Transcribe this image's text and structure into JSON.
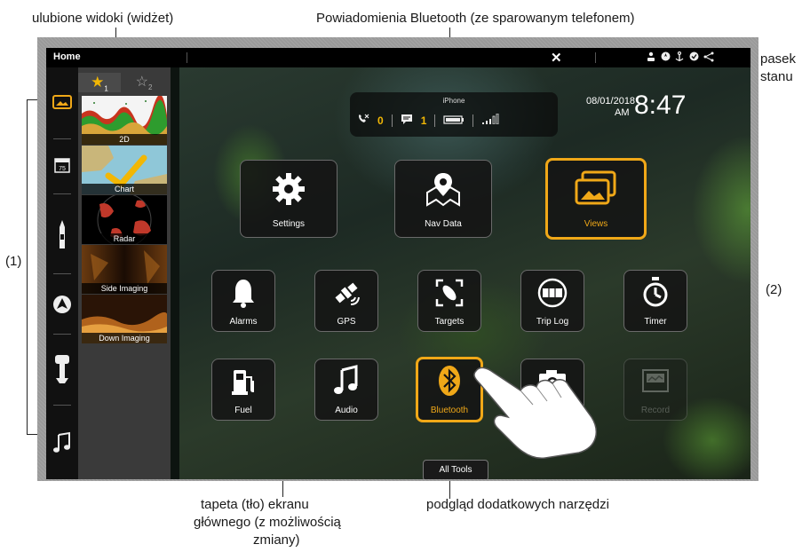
{
  "callouts": {
    "favorites_widget": "ulubione widoki (widżet)",
    "bluetooth_notifications": "Powiadomienia Bluetooth (ze sparowanym telefonem)",
    "status_bar_line1": "pasek",
    "status_bar_line2": "stanu",
    "label_1": "(1)",
    "label_2": "(2)",
    "wallpaper_line1": "tapeta (tło) ekranu",
    "wallpaper_line2": "głównego (z możliwością",
    "wallpaper_line3": "zmiany)",
    "more_tools": "podgląd dodatkowych narzędzi"
  },
  "topbar": {
    "title": "Home",
    "close_glyph": "✕",
    "status_icons": [
      "user-icon",
      "compass-icon",
      "anchor-icon",
      "gps-check-icon",
      "network-icon"
    ]
  },
  "leftbar": {
    "items": [
      "views-icon",
      "calendar-75-icon",
      "boat-icon",
      "autopilot-icon",
      "motor-icon",
      "audio-icon"
    ],
    "calendar_value": "75"
  },
  "favorites": {
    "tab1_label": "1",
    "tab2_label": "2",
    "views": [
      "2D",
      "Chart",
      "Radar",
      "Side Imaging",
      "Down Imaging"
    ]
  },
  "notification": {
    "device": "iPhone",
    "missed_calls": "0",
    "messages": "1"
  },
  "clock": {
    "date": "08/01/2018",
    "ampm": "AM",
    "time": "8:47"
  },
  "tiles": {
    "big": [
      {
        "label": "Settings",
        "icon": "gear-icon"
      },
      {
        "label": "Nav Data",
        "icon": "map-pin-icon"
      },
      {
        "label": "Views",
        "icon": "views-icon"
      }
    ],
    "row2": [
      {
        "label": "Alarms",
        "icon": "bell-icon"
      },
      {
        "label": "GPS",
        "icon": "satellite-icon"
      },
      {
        "label": "Targets",
        "icon": "target-icon"
      },
      {
        "label": "Trip Log",
        "icon": "odometer-icon"
      },
      {
        "label": "Timer",
        "icon": "stopwatch-icon"
      }
    ],
    "row3": [
      {
        "label": "Fuel",
        "icon": "fuel-pump-icon"
      },
      {
        "label": "Audio",
        "icon": "music-note-icon"
      },
      {
        "label": "Bluetooth",
        "icon": "bluetooth-icon"
      },
      {
        "label": "Record",
        "icon": "record-icon"
      }
    ]
  },
  "all_tools": "All Tools",
  "colors": {
    "accent": "#f0a818",
    "star": "#f2b705"
  }
}
